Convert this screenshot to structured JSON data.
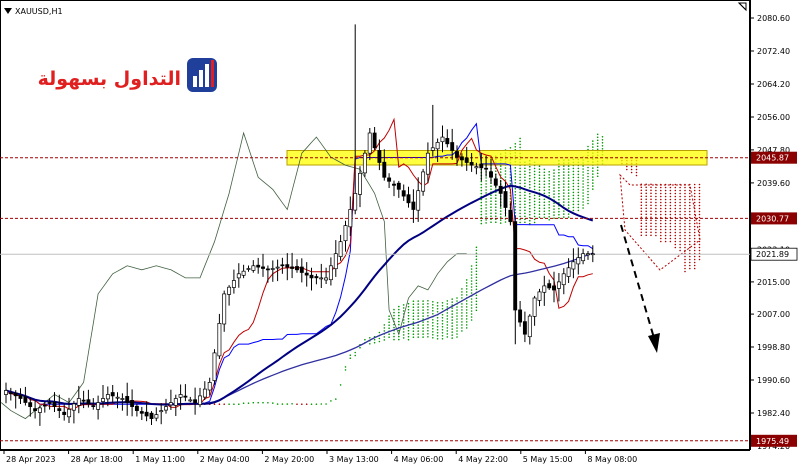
{
  "window": {
    "symbol_label": "XAUUSD,H1"
  },
  "logo": {
    "text": "التداول بسهولة"
  },
  "colors": {
    "background": "#ffffff",
    "candle": "#000000",
    "price_line_dashed": "#a00000",
    "current_price_bg": "#ffffff",
    "current_price_fg": "#000000",
    "level_tag_bg": "#8b0000",
    "level_tag_fg": "#ffffff",
    "resistance_zone": "#ffff00",
    "kumo_bull": "#009900",
    "kumo_bear": "#b00000",
    "tenkan": "#c00000",
    "kijun": "#0000ff",
    "ma_fast": "#000080",
    "ma_slow": "#3030a0",
    "chikou": "#406040",
    "arrow": "#000000"
  },
  "price_axis": {
    "ticks": [
      "2080.60",
      "2072.40",
      "2064.20",
      "2056.00",
      "2047.80",
      "2039.60",
      "2031.30",
      "2023.10",
      "2015.00",
      "2007.00",
      "1998.80",
      "1990.60",
      "1982.40",
      "1974.20"
    ]
  },
  "levels": [
    {
      "name": "resistance",
      "value": "2045.87"
    },
    {
      "name": "mid",
      "value": "2030.77"
    },
    {
      "name": "support",
      "value": "1975.49"
    }
  ],
  "current_price": "2021.89",
  "time_axis": {
    "labels": [
      "28 Apr 2023",
      "28 Apr 18:00",
      "1 May 11:00",
      "2 May 04:00",
      "2 May 20:00",
      "3 May 13:00",
      "4 May 06:00",
      "4 May 22:00",
      "5 May 15:00",
      "8 May 08:00"
    ]
  },
  "chart_data": {
    "type": "candlestick",
    "instrument": "XAUUSD",
    "timeframe": "H1",
    "y_range": [
      1974.2,
      2080.6
    ],
    "close_points": [
      [
        0,
        1988
      ],
      [
        3,
        1986
      ],
      [
        6,
        1983
      ],
      [
        9,
        1985
      ],
      [
        12,
        1982
      ],
      [
        15,
        1986
      ],
      [
        18,
        1984
      ],
      [
        21,
        1987
      ],
      [
        24,
        1986
      ],
      [
        27,
        1983
      ],
      [
        30,
        1981
      ],
      [
        33,
        1984
      ],
      [
        36,
        1987
      ],
      [
        39,
        1985
      ],
      [
        42,
        1990
      ],
      [
        45,
        2012
      ],
      [
        48,
        2017
      ],
      [
        51,
        2019
      ],
      [
        54,
        2018
      ],
      [
        57,
        2019
      ],
      [
        60,
        2018
      ],
      [
        63,
        2016
      ],
      [
        66,
        2016
      ],
      [
        69,
        2025
      ],
      [
        72,
        2037
      ],
      [
        75,
        2052
      ],
      [
        78,
        2041
      ],
      [
        81,
        2038
      ],
      [
        84,
        2033
      ],
      [
        87,
        2047
      ],
      [
        90,
        2051
      ],
      [
        93,
        2046
      ],
      [
        96,
        2044
      ],
      [
        99,
        2043
      ],
      [
        102,
        2037
      ],
      [
        104,
        2030
      ],
      [
        105,
        2008
      ],
      [
        107,
        2002
      ],
      [
        109,
        2011
      ],
      [
        111,
        2014
      ],
      [
        113,
        2013
      ],
      [
        115,
        2017
      ],
      [
        117,
        2020
      ],
      [
        119,
        2022
      ],
      [
        121,
        2022
      ]
    ],
    "levels": [
      2045.87,
      2030.77,
      1975.49
    ],
    "last_price": 2021.89
  }
}
